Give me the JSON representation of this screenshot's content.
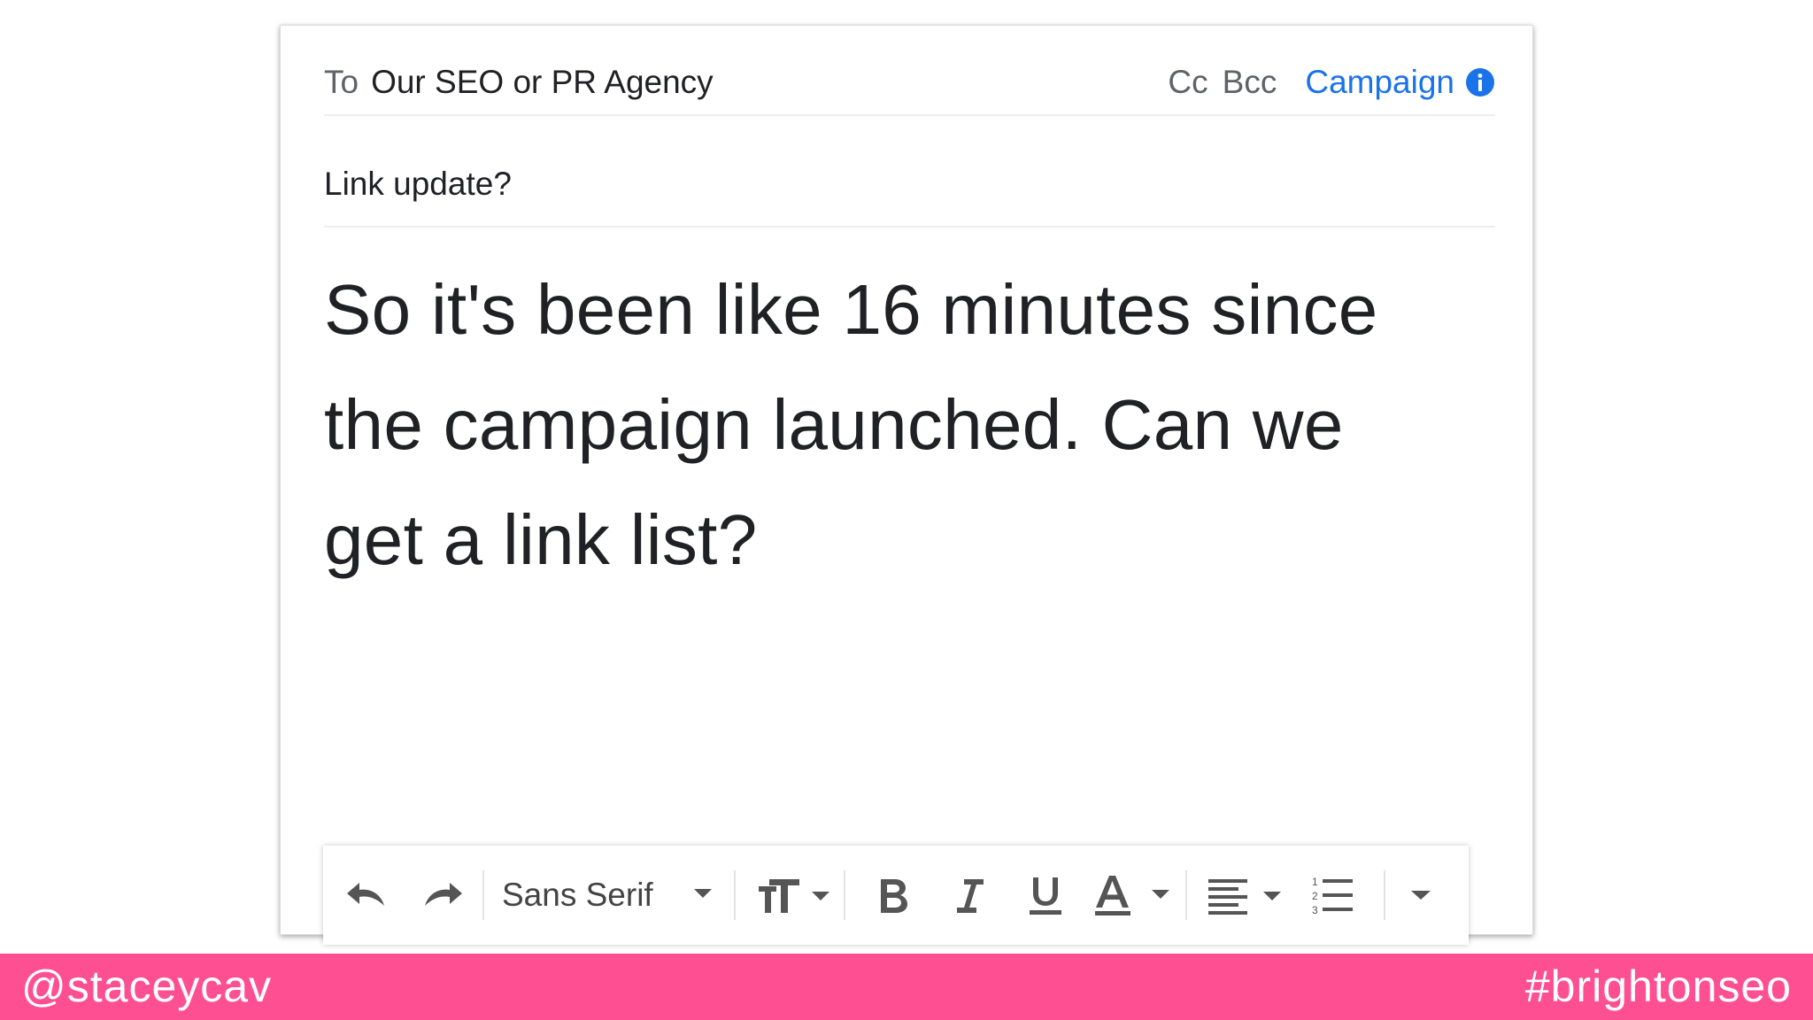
{
  "compose": {
    "to_label": "To",
    "to_value": "Our SEO or PR Agency",
    "cc_label": "Cc",
    "bcc_label": "Bcc",
    "campaign_label": "Campaign",
    "subject": "Link update?",
    "body_lines": [
      "So it's been like 16 minutes since",
      "the campaign launched. Can we",
      "get a link list?"
    ]
  },
  "toolbar": {
    "font_name": "Sans Serif",
    "icons": [
      "undo-icon",
      "redo-icon",
      "font-dropdown-icon",
      "text-size-icon",
      "bold-icon",
      "italic-icon",
      "underline-icon",
      "text-color-icon",
      "align-icon",
      "numbered-list-icon",
      "more-options-icon"
    ]
  },
  "footer": {
    "handle": "@staceycav",
    "hashtag": "#brightonseo",
    "bg_color": "#ff4f93"
  },
  "colors": {
    "link_blue": "#1a73e8",
    "text": "#202124",
    "muted": "#5f6368"
  }
}
